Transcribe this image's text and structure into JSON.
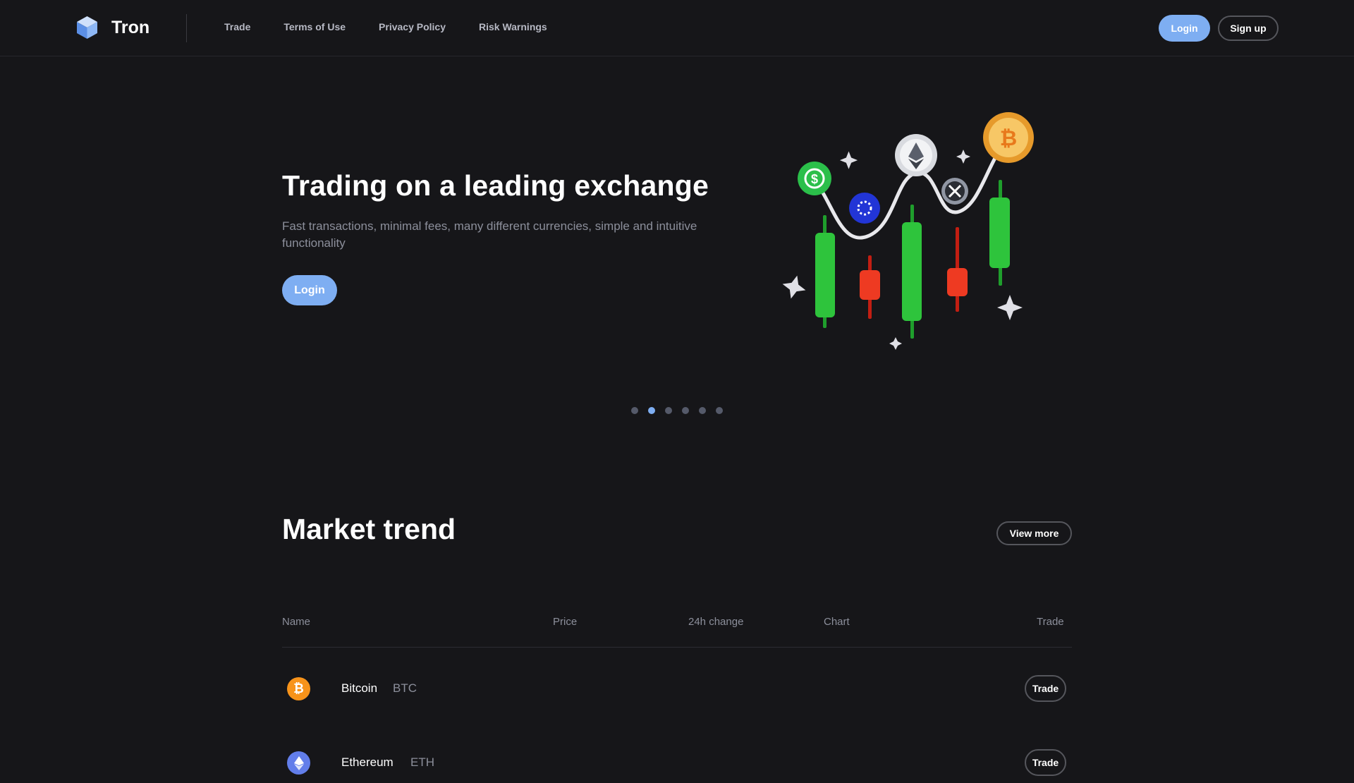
{
  "brand": {
    "name": "Tron",
    "accent": "#7eaef2"
  },
  "nav": {
    "items": [
      "Trade",
      "Terms of Use",
      "Privacy Policy",
      "Risk Warnings"
    ]
  },
  "header": {
    "login_label": "Login",
    "signup_label": "Sign up"
  },
  "hero": {
    "title": "Trading on a leading exchange",
    "subtitle": "Fast transactions, minimal fees, many different currencies, simple and intuitive functionality",
    "login_label": "Login",
    "carousel": {
      "count": 6,
      "active_index": 1
    }
  },
  "market": {
    "title": "Market trend",
    "view_more_label": "View more",
    "columns": [
      "Name",
      "Price",
      "24h change",
      "Chart",
      "Trade"
    ],
    "rows": [
      {
        "name": "Bitcoin",
        "symbol": "BTC",
        "icon": "bitcoin-icon",
        "icon_color": "#f7931a",
        "trade_label": "Trade"
      },
      {
        "name": "Ethereum",
        "symbol": "ETH",
        "icon": "ethereum-icon",
        "icon_color": "#627eea",
        "trade_label": "Trade"
      }
    ]
  }
}
